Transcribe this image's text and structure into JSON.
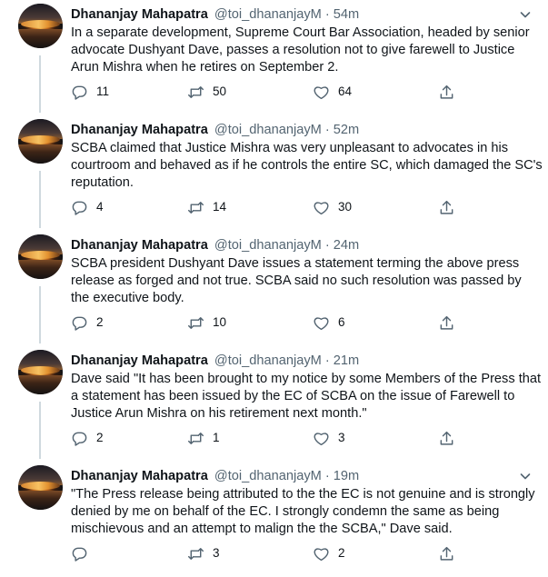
{
  "tweets": [
    {
      "name": "Dhananjay Mahapatra",
      "handle": "@toi_dhananjayM",
      "separator": "·",
      "time": "54m",
      "text": "In a separate development, Supreme Court Bar Association, headed by senior advocate Dushyant Dave, passes a resolution not to give farewell to Justice Arun Mishra when he retires on September 2.",
      "replies": "11",
      "retweets": "50",
      "likes": "64"
    },
    {
      "name": "Dhananjay Mahapatra",
      "handle": "@toi_dhananjayM",
      "separator": "·",
      "time": "52m",
      "text": "SCBA claimed that Justice Mishra was very unpleasant to advocates in his courtroom and behaved as if he controls the entire SC, which damaged the SC's reputation.",
      "replies": "4",
      "retweets": "14",
      "likes": "30"
    },
    {
      "name": "Dhananjay Mahapatra",
      "handle": "@toi_dhananjayM",
      "separator": "·",
      "time": "24m",
      "text": "SCBA president Dushyant Dave issues a statement terming the above press release as forged and not true. SCBA said no such resolution was passed by the executive body.",
      "replies": "2",
      "retweets": "10",
      "likes": "6"
    },
    {
      "name": "Dhananjay Mahapatra",
      "handle": "@toi_dhananjayM",
      "separator": "·",
      "time": "21m",
      "text": "Dave said \"It has been brought to my notice by some Members of the Press that a statement has been issued by the EC of SCBA on the issue of Farewell to Justice Arun Mishra on his retirement next month.\"",
      "replies": "2",
      "retweets": "1",
      "likes": "3"
    },
    {
      "name": "Dhananjay Mahapatra",
      "handle": "@toi_dhananjayM",
      "separator": "·",
      "time": "19m",
      "text": "\"The Press release being attributed to the the EC is not genuine and is strongly denied by me on behalf of the EC. I strongly condemn the same as being mischievous and an attempt to malign the the SCBA,\" Dave said.",
      "replies": "",
      "retweets": "3",
      "likes": "2"
    }
  ],
  "icons": {
    "reply": "reply-icon",
    "retweet": "retweet-icon",
    "like": "like-icon",
    "share": "share-icon",
    "more": "chevron-down-icon"
  },
  "colors": {
    "text": "#0f1419",
    "secondary": "#536471",
    "thread_line": "#cfd9de"
  }
}
